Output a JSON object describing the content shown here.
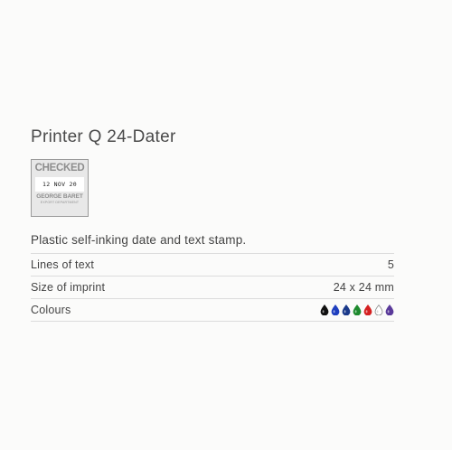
{
  "product": {
    "title": "Printer Q 24-Dater",
    "description": "Plastic self-inking date and text stamp.",
    "stamp_image": {
      "line1": "CHECKED",
      "date": "12 NOV 20",
      "line2": "GEORGE BARET",
      "line3": "EXPORT DEPARTMENT"
    },
    "specs": [
      {
        "label": "Lines of text",
        "value": "5"
      },
      {
        "label": "Size of imprint",
        "value": "24 x 24 mm"
      },
      {
        "label": "Colours",
        "value": ""
      }
    ],
    "colours": [
      {
        "name": "black",
        "hex": "#111111"
      },
      {
        "name": "blue",
        "hex": "#1f3fbf"
      },
      {
        "name": "navy",
        "hex": "#1b3a8a"
      },
      {
        "name": "green",
        "hex": "#1e8a2e"
      },
      {
        "name": "red",
        "hex": "#d42020"
      },
      {
        "name": "white",
        "hex": "#ffffff"
      },
      {
        "name": "violet",
        "hex": "#5a3a9a"
      }
    ]
  }
}
